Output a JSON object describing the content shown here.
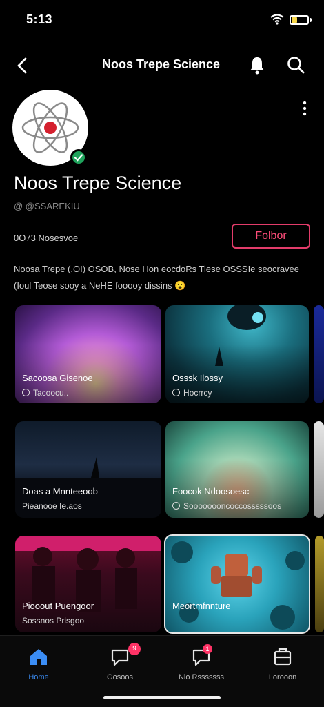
{
  "status_bar": {
    "time": "5:13",
    "icons": [
      "wifi-icon",
      "battery-icon"
    ],
    "battery_color": "#f5d547"
  },
  "nav_bar": {
    "title": "Noos Trepe Science",
    "icons": [
      "back-icon",
      "bell-icon",
      "search-icon"
    ]
  },
  "channel": {
    "name": "Noos Trepe Science",
    "handle": "@ @SSAREKIU",
    "stats": "0O73 Nosesvoe",
    "follow_label": "Folbor",
    "description": "Noosa Trepe (.OI) OSOB, Nose Hon eocdoRs Tiese OSSSIe seocravee (Ioul Teose sooy a NeHE fooooy dissins",
    "description_emoji": "😮",
    "accent_color": "#e23c6a",
    "verified_color": "#1fa35c"
  },
  "videos": [
    {
      "title": "Sacoosa Gisenoe",
      "meta": "Tacoocu..",
      "has_clock": true
    },
    {
      "title": "Osssk Ilossy",
      "meta": "Hocrrcy",
      "has_clock": true
    },
    {
      "title": "Doas a Mnnteeoob",
      "meta": "Pieanooe Ie.aos",
      "has_clock": false
    },
    {
      "title": "Foocok Ndoosoesc",
      "meta": "Soooooooncoccosssssoos",
      "has_clock": true
    },
    {
      "title": "Piooout Puengoor",
      "meta": "Sossnos Prisgoo",
      "has_clock": false
    },
    {
      "title": "Meortmfnnture",
      "meta": "",
      "has_clock": false
    }
  ],
  "bottom_nav": {
    "items": [
      {
        "label": "Home",
        "icon": "home-icon",
        "active": true
      },
      {
        "label": "Gosoos",
        "icon": "chat-icon",
        "badge": "9"
      },
      {
        "label": "Nio Rsssssss",
        "icon": "notification-icon",
        "badge": "1"
      },
      {
        "label": "Lorooon",
        "icon": "inbox-icon"
      }
    ],
    "active_color": "#3b8df5",
    "badge_color": "#ff3366"
  }
}
